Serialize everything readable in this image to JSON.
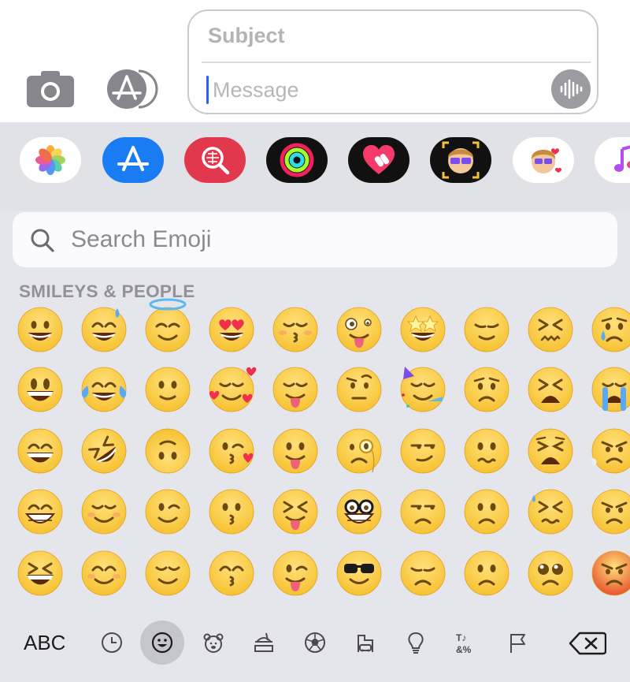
{
  "compose": {
    "subject_placeholder": "Subject",
    "message_placeholder": "Message",
    "camera_icon": "camera-icon",
    "appstore_icon": "appstore-icon",
    "mic_icon": "waveform-icon"
  },
  "app_strip": {
    "apps": [
      {
        "name": "photos-app-icon",
        "bg": "#ffffff"
      },
      {
        "name": "appstore-app-icon",
        "bg": "#1a7cf2"
      },
      {
        "name": "images-search-app-icon",
        "bg": "#e2384e"
      },
      {
        "name": "activity-app-icon",
        "bg": "#111111"
      },
      {
        "name": "digital-touch-app-icon",
        "bg": "#111111"
      },
      {
        "name": "memoji-camera-app-icon",
        "bg": "#111111"
      },
      {
        "name": "memoji-stickers-app-icon",
        "bg": "#ffffff"
      },
      {
        "name": "music-app-icon",
        "bg": "#ffffff"
      }
    ]
  },
  "emoji_keyboard": {
    "search_placeholder": "Search Emoji",
    "section_title": "SMILEYS & PEOPLE",
    "rows": [
      [
        "grinning-face",
        "grinning-face-with-sweat",
        "smiling-face-with-halo",
        "smiling-face-with-heart-eyes",
        "kissing-face-with-closed-eyes",
        "zany-face",
        "star-struck",
        "pensive-face",
        "confounded-face",
        "crying-face"
      ],
      [
        "grinning-face-with-big-eyes",
        "face-with-tears-of-joy",
        "slightly-smiling-face",
        "smiling-face-with-hearts",
        "face-savoring-food",
        "face-with-raised-eyebrow",
        "partying-face",
        "worried-face",
        "tired-face",
        "loudly-crying-face"
      ],
      [
        "grinning-face-with-smiling-eyes",
        "rolling-on-the-floor-laughing",
        "upside-down-face",
        "face-blowing-a-kiss",
        "face-with-tongue",
        "face-with-monocle",
        "smirking-face",
        "confused-face",
        "weary-face",
        "face-with-steam-from-nose"
      ],
      [
        "beaming-face-with-smiling-eyes",
        "smiling-face",
        "winking-face",
        "kissing-face",
        "squinting-face-with-tongue",
        "nerd-face",
        "unamused-face",
        "slightly-frowning-face",
        "persevering-face",
        "angry-face"
      ],
      [
        "grinning-squinting-face",
        "smiling-face-with-smiling-eyes",
        "relieved-face",
        "kissing-face-with-smiling-eyes",
        "winking-face-with-tongue",
        "smiling-face-with-sunglasses",
        "disappointed-face",
        "frowning-face",
        "pleading-face",
        "pouting-face"
      ]
    ],
    "bottom_bar": {
      "abc_label": "ABC",
      "categories": [
        "recent-clock-icon",
        "smileys-icon",
        "animals-bear-icon",
        "food-icon",
        "activity-soccer-icon",
        "travel-icon",
        "objects-lightbulb-icon",
        "symbols-icon",
        "flags-icon"
      ],
      "active_category": "smileys-icon",
      "backspace_icon": "backspace-icon"
    }
  },
  "colors": {
    "emoji_yellow": "#f7c232",
    "keyboard_bg": "#e5e6eb",
    "cursor_blue": "#2f5ff0",
    "feature_dark": "#6b4a12"
  }
}
